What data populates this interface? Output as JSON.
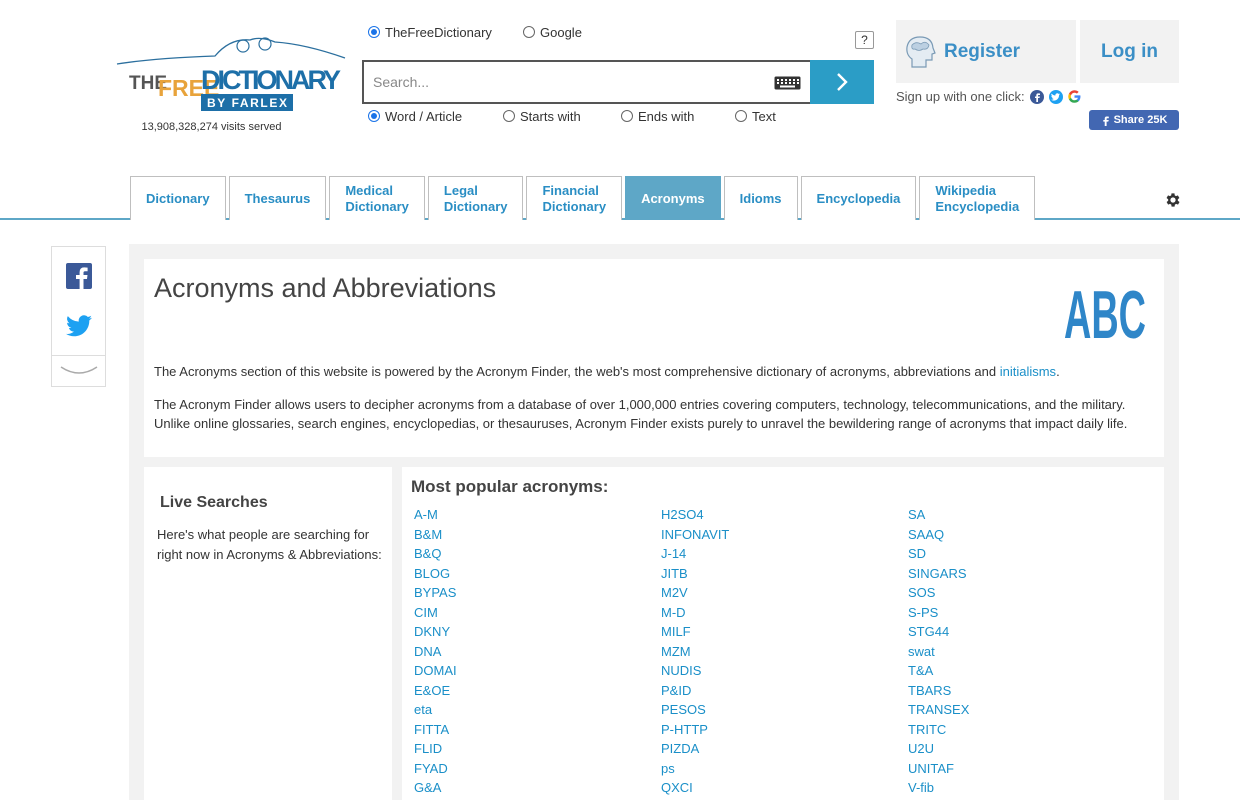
{
  "header": {
    "visits": "13,908,328,274 visits served",
    "sources": [
      {
        "label": "TheFreeDictionary",
        "checked": true
      },
      {
        "label": "Google",
        "checked": false
      }
    ],
    "help": "?",
    "search_placeholder": "Search...",
    "modes": [
      {
        "label": "Word / Article",
        "checked": true
      },
      {
        "label": "Starts with",
        "checked": false
      },
      {
        "label": "Ends with",
        "checked": false
      },
      {
        "label": "Text",
        "checked": false
      }
    ],
    "register": "Register",
    "login": "Log in",
    "signup": "Sign up with one click:",
    "fb_share": "Share 25K"
  },
  "tabs": [
    {
      "line1": "Dictionary",
      "line2": ""
    },
    {
      "line1": "Thesaurus",
      "line2": ""
    },
    {
      "line1": "Medical",
      "line2": "Dictionary"
    },
    {
      "line1": "Legal",
      "line2": "Dictionary"
    },
    {
      "line1": "Financial",
      "line2": "Dictionary"
    },
    {
      "line1": "Acronyms",
      "line2": ""
    },
    {
      "line1": "Idioms",
      "line2": ""
    },
    {
      "line1": "Encyclopedia",
      "line2": ""
    },
    {
      "line1": "Wikipedia",
      "line2": "Encyclopedia"
    }
  ],
  "active_tab": "Acronyms",
  "colors": {
    "accent": "#2b9dc6",
    "tab_active": "#5ea7c7",
    "link": "#1a8fc8"
  },
  "main": {
    "title": "Acronyms and Abbreviations",
    "intro_1_pre": "The Acronyms section of this website is powered by the Acronym Finder, the web's most comprehensive dictionary of acronyms, abbreviations and ",
    "intro_1_link": "initialisms",
    "intro_1_post": ".",
    "intro_2_line1": "The Acronym Finder allows users to decipher acronyms from a database of over 1,000,000 entries covering computers, technology, telecommunications, and the military.",
    "intro_2_line2": "Unlike online glossaries, search engines, encyclopedias, or thesauruses, Acronym Finder exists purely to unravel the bewildering range of acronyms that impact daily life."
  },
  "live": {
    "title": "Live Searches",
    "desc": "Here's what people are searching for right now in Acronyms & Abbreviations:"
  },
  "popular": {
    "title": "Most popular acronyms:",
    "col1": [
      "A-M",
      "B&M",
      "B&Q",
      "BLOG",
      "BYPAS",
      "CIM",
      "DKNY",
      "DNA",
      "DOMAI",
      "E&OE",
      "eta",
      "FITTA",
      "FLID",
      "FYAD",
      "G&A"
    ],
    "col2": [
      "H2SO4",
      "INFONAVIT",
      "J-14",
      "JITB",
      "M2V",
      "M-D",
      "MILF",
      "MZM",
      "NUDIS",
      "P&ID",
      "PESOS",
      "P-HTTP",
      "PIZDA",
      "ps",
      "QXCI"
    ],
    "col3": [
      "SA",
      "SAAQ",
      "SD",
      "SINGARS",
      "SOS",
      "S-PS",
      "STG44",
      "swat",
      "T&A",
      "TBARS",
      "TRANSEX",
      "TRITC",
      "U2U",
      "UNITAF",
      "V-fib"
    ]
  }
}
